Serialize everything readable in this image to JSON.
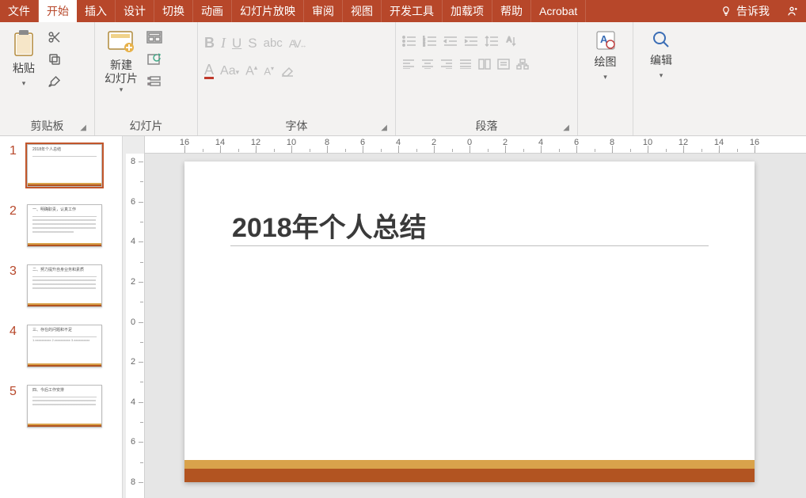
{
  "tabs": {
    "file": "文件",
    "home": "开始",
    "insert": "插入",
    "design": "设计",
    "transitions": "切换",
    "animations": "动画",
    "slideshow": "幻灯片放映",
    "review": "审阅",
    "view": "视图",
    "developer": "开发工具",
    "addins": "加载项",
    "help": "帮助",
    "acrobat": "Acrobat",
    "tellme": "告诉我"
  },
  "ribbon": {
    "clipboard": {
      "paste": "粘贴",
      "label": "剪贴板"
    },
    "slides": {
      "newslide": "新建\n幻灯片",
      "label": "幻灯片"
    },
    "font": {
      "label": "字体"
    },
    "paragraph": {
      "label": "段落"
    },
    "drawing": {
      "draw": "绘图",
      "label": ""
    },
    "editing": {
      "edit": "编辑",
      "label": ""
    }
  },
  "thumbs": [
    {
      "num": "1",
      "title": "2018年个人总结",
      "body": ""
    },
    {
      "num": "2",
      "title": "一、明确职责，认真工作",
      "body": "xxxxxxxxxxxxxxxxxxxxxxxxxxxxxxxxxxxxxxxxxxxxxxxxxxxxxxxxxxxxxxxxxxxxxxxxxxxxxxxxxxxxxxxxxxxxxxxxxxxxxxxxxxxxxxxxxxxxxxxxxxxxxxxxxxxxxxxxxxxxxxxxxx"
    },
    {
      "num": "3",
      "title": "二、努力提升自身业务和素质",
      "body": "xxxxxxxxxxxxxxxxxxxxxxxxxxxxxxxxxxxxxxxxxxxxxxxxxxxxxxxxxxxxxxxxxxxxxxxxxxxxxxxxxxxxxxxxxxxxxxxxxxxxxxxxxxxxxxxxxxxxxxxx"
    },
    {
      "num": "4",
      "title": "三、存在的问题和不足",
      "body": "1.xxxxxxxxxx\n2.xxxxxxxxxx\n3.xxxxxxxxxx"
    },
    {
      "num": "5",
      "title": "四、今后工作安排",
      "body": "xxxxxxxxxxxxxxxxxxxxxxxxxxxxxxxxxxxxxxxxxxxxxxxxxxxxxxxxxxxxxxxxxxxxxxxxxxxxxxxx"
    }
  ],
  "slide": {
    "title": "2018年个人总结"
  },
  "ruler": {
    "h": [
      "16",
      "14",
      "12",
      "10",
      "8",
      "6",
      "4",
      "2",
      "0",
      "2",
      "4",
      "6",
      "8",
      "10",
      "12",
      "14",
      "16"
    ],
    "v": [
      "8",
      "6",
      "4",
      "2",
      "0",
      "2",
      "4",
      "6",
      "8"
    ]
  }
}
